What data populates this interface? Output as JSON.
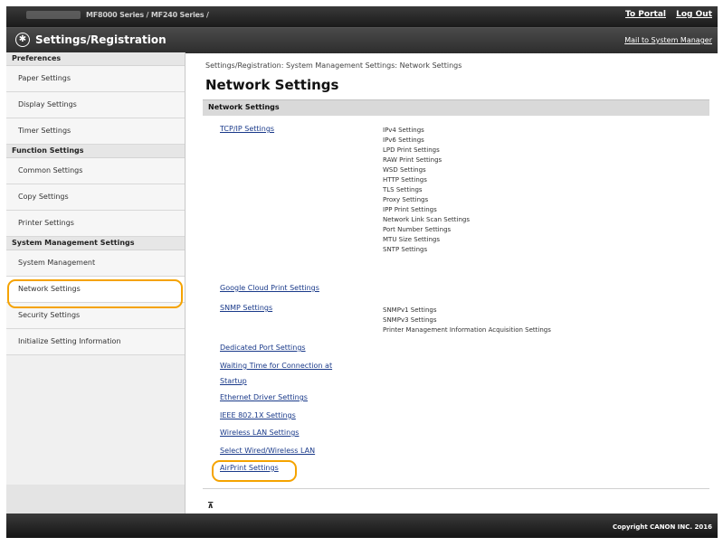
{
  "topbar": {
    "model": "MF8000 Series / MF240 Series /",
    "to_portal": "To Portal",
    "log_out": "Log Out"
  },
  "titlebar": {
    "title": "Settings/Registration",
    "mail_link": "Mail to System Manager",
    "icon": "settings-gear-icon"
  },
  "sidebar": {
    "sections": [
      {
        "heading": "Preferences",
        "items": [
          "Paper Settings",
          "Display Settings",
          "Timer Settings"
        ]
      },
      {
        "heading": "Function Settings",
        "items": [
          "Common Settings",
          "Copy Settings",
          "Printer Settings"
        ]
      },
      {
        "heading": "System Management Settings",
        "items": [
          "System Management",
          "Network Settings",
          "Security Settings",
          "Initialize Setting Information"
        ]
      }
    ],
    "active_item": "Network Settings"
  },
  "main": {
    "breadcrumb": "Settings/Registration: System Management Settings: Network Settings",
    "page_title": "Network Settings",
    "section_title": "Network Settings",
    "links": [
      "TCP/IP Settings",
      "Google Cloud Print Settings",
      "SNMP Settings",
      "Dedicated Port Settings",
      "Waiting Time for Connection at",
      "Startup",
      "Ethernet Driver Settings",
      "IEEE 802.1X Settings",
      "Wireless LAN Settings",
      "Select Wired/Wireless LAN",
      "AirPrint Settings"
    ],
    "tcpip_subitems": [
      "IPv4 Settings",
      "IPv6 Settings",
      "LPD Print Settings",
      "RAW Print Settings",
      "WSD Settings",
      "HTTP Settings",
      "TLS Settings",
      "Proxy Settings",
      "IPP Print Settings",
      "Network Link Scan Settings",
      "Port Number Settings",
      "MTU Size Settings",
      "SNTP Settings"
    ],
    "snmp_subitems": [
      "SNMPv1 Settings",
      "SNMPv3 Settings",
      "Printer Management Information Acquisition Settings"
    ],
    "top_icon": "scroll-to-top-icon"
  },
  "footer": {
    "copyright": "Copyright CANON INC. 2016"
  },
  "colors": {
    "highlight": "#f5a300",
    "link": "#1a3a8a",
    "header_bg": "#2d2d2d"
  }
}
